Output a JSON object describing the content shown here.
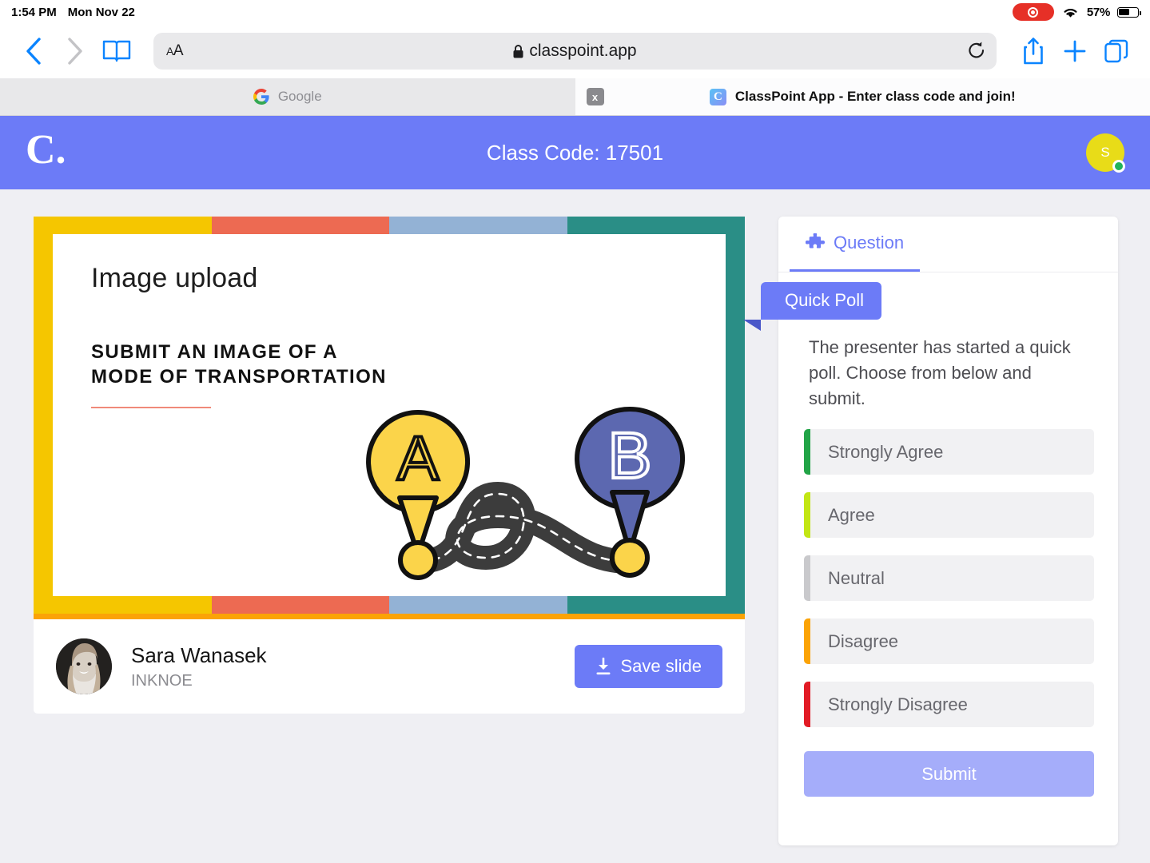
{
  "status_bar": {
    "time": "1:54 PM",
    "date": "Mon Nov 22",
    "battery_percent": "57%",
    "recording_icon": "record-indicator",
    "wifi_icon": "wifi-icon"
  },
  "browser": {
    "back_icon": "back-chevron-icon",
    "forward_icon": "forward-chevron-icon",
    "bookmarks_icon": "book-icon",
    "text_size_label": "AA",
    "url": "classpoint.app",
    "lock_icon": "lock-icon",
    "reload_icon": "reload-icon",
    "share_icon": "share-icon",
    "new_tab_icon": "plus-icon",
    "tabs_icon": "tabs-overview-icon",
    "tabs": [
      {
        "title": "Google",
        "favicon": "google-icon",
        "active": false,
        "close_label": "x"
      },
      {
        "title": "ClassPoint App - Enter class code and join!",
        "favicon": "classpoint-favicon",
        "active": true
      }
    ]
  },
  "app_header": {
    "logo": "C.",
    "title": "Class Code: 17501",
    "avatar_initial": "S",
    "brand_color": "#6c7bf7",
    "avatar_color": "#e8dc18",
    "online_color": "#21b35a"
  },
  "slide": {
    "heading": "Image upload",
    "subtitle_line1": "SUBMIT AN IMAGE OF A",
    "subtitle_line2": "MODE OF TRANSPORTATION",
    "band_colors": [
      "#f5c600",
      "#ed6a52",
      "#93b2d5",
      "#2a8e86"
    ],
    "rule_color": "#f08a7a",
    "progress_color": "#fba306",
    "art": {
      "pin_a_label": "A",
      "pin_a_color": "#fbd44a",
      "pin_b_label": "B",
      "pin_b_color": "#5c68b0",
      "road_color": "#3c3c3c"
    }
  },
  "presenter": {
    "name": "Sara Wanasek",
    "organization": "INKNOE",
    "save_label": "Save slide",
    "save_icon": "download-icon"
  },
  "question_panel": {
    "tab_label": "Question",
    "tab_icon": "puzzle-piece-icon",
    "ribbon_label": "Quick Poll",
    "prompt": "The presenter has started a quick poll. Choose from below and submit.",
    "options": [
      {
        "label": "Strongly Agree",
        "color": "#22a447"
      },
      {
        "label": "Agree",
        "color": "#c2e614"
      },
      {
        "label": "Neutral",
        "color": "#c9c9cc"
      },
      {
        "label": "Disagree",
        "color": "#fba306"
      },
      {
        "label": "Strongly Disagree",
        "color": "#e21b25"
      }
    ],
    "submit_label": "Submit"
  }
}
